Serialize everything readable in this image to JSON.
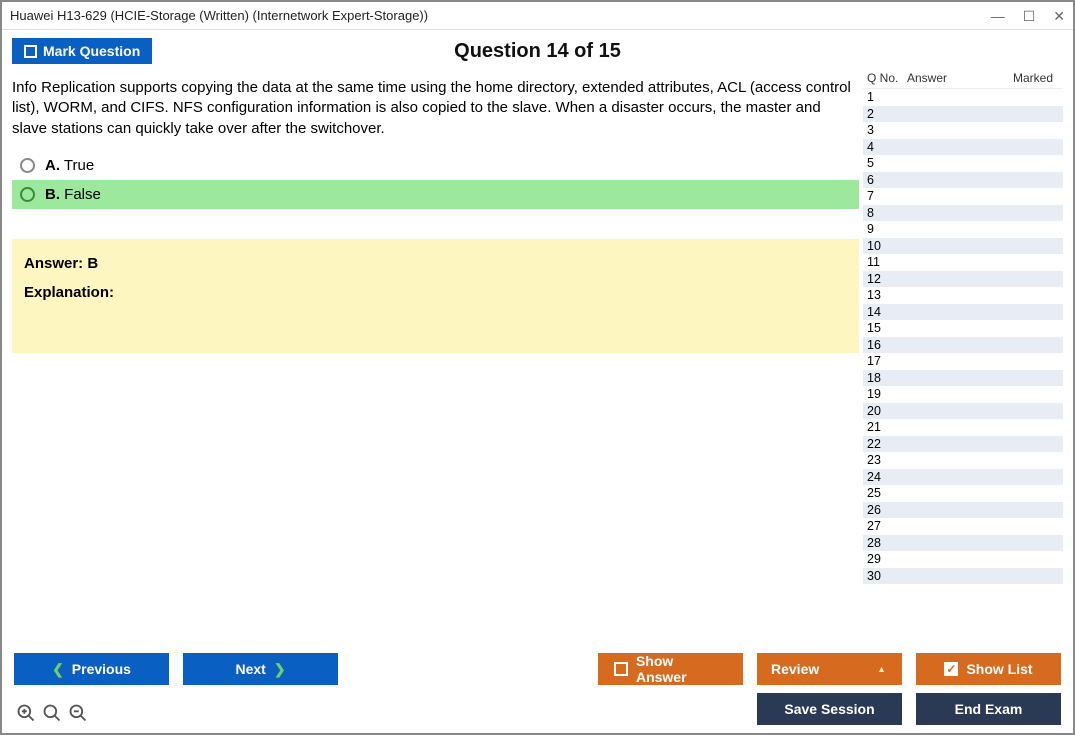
{
  "window_title": "Huawei H13-629 (HCIE-Storage (Written) (Internetwork Expert-Storage))",
  "mark_label": "Mark Question",
  "question_header": "Question 14 of 15",
  "question_text": "Info Replication supports copying the data at the same time using the home directory, extended attributes, ACL (access control list), WORM, and CIFS. NFS configuration information is also copied to the slave. When a disaster occurs, the master and slave stations can quickly take over after the switchover.",
  "options": [
    {
      "letter": "A.",
      "text": "True",
      "selected": false
    },
    {
      "letter": "B.",
      "text": "False",
      "selected": true
    }
  ],
  "answer_line": "Answer: B",
  "explanation_label": "Explanation:",
  "side_headers": {
    "qno": "Q No.",
    "answer": "Answer",
    "marked": "Marked"
  },
  "qcount": 30,
  "buttons": {
    "previous": "Previous",
    "next": "Next",
    "show_answer": "Show Answer",
    "review": "Review",
    "show_list": "Show List",
    "save_session": "Save Session",
    "end_exam": "End Exam"
  }
}
